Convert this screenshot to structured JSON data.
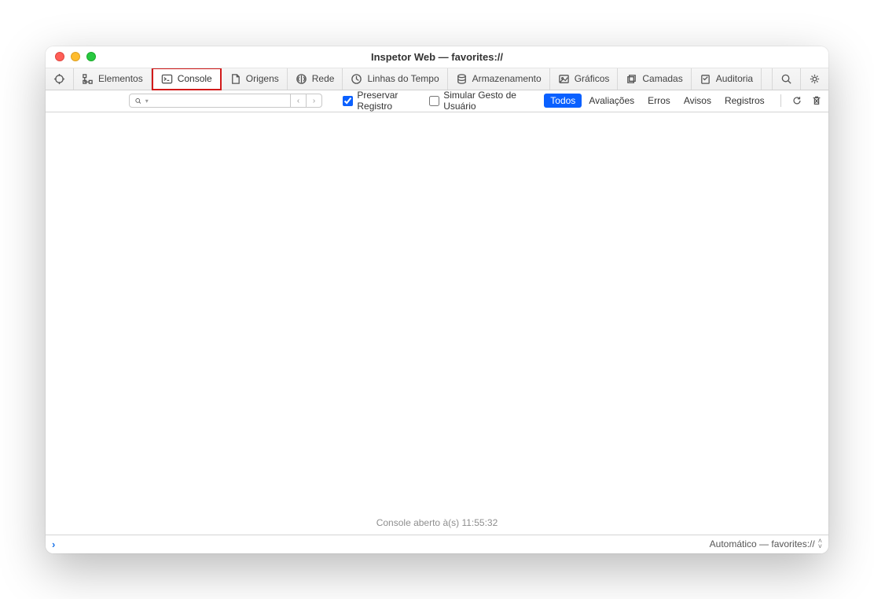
{
  "window": {
    "title": "Inspetor Web — favorites://"
  },
  "tabs": {
    "elementos": "Elementos",
    "console": "Console",
    "origens": "Origens",
    "rede": "Rede",
    "linhas": "Linhas do Tempo",
    "armazenamento": "Armazenamento",
    "graficos": "Gráficos",
    "camadas": "Camadas",
    "auditoria": "Auditoria"
  },
  "filter": {
    "preservar": "Preservar Registro",
    "simular": "Simular Gesto de Usuário",
    "todos": "Todos",
    "avaliacoes": "Avaliações",
    "erros": "Erros",
    "avisos": "Avisos",
    "registros": "Registros"
  },
  "console_message": "Console aberto à(s) 11:55:32",
  "footer": {
    "context": "Automático — favorites://"
  }
}
